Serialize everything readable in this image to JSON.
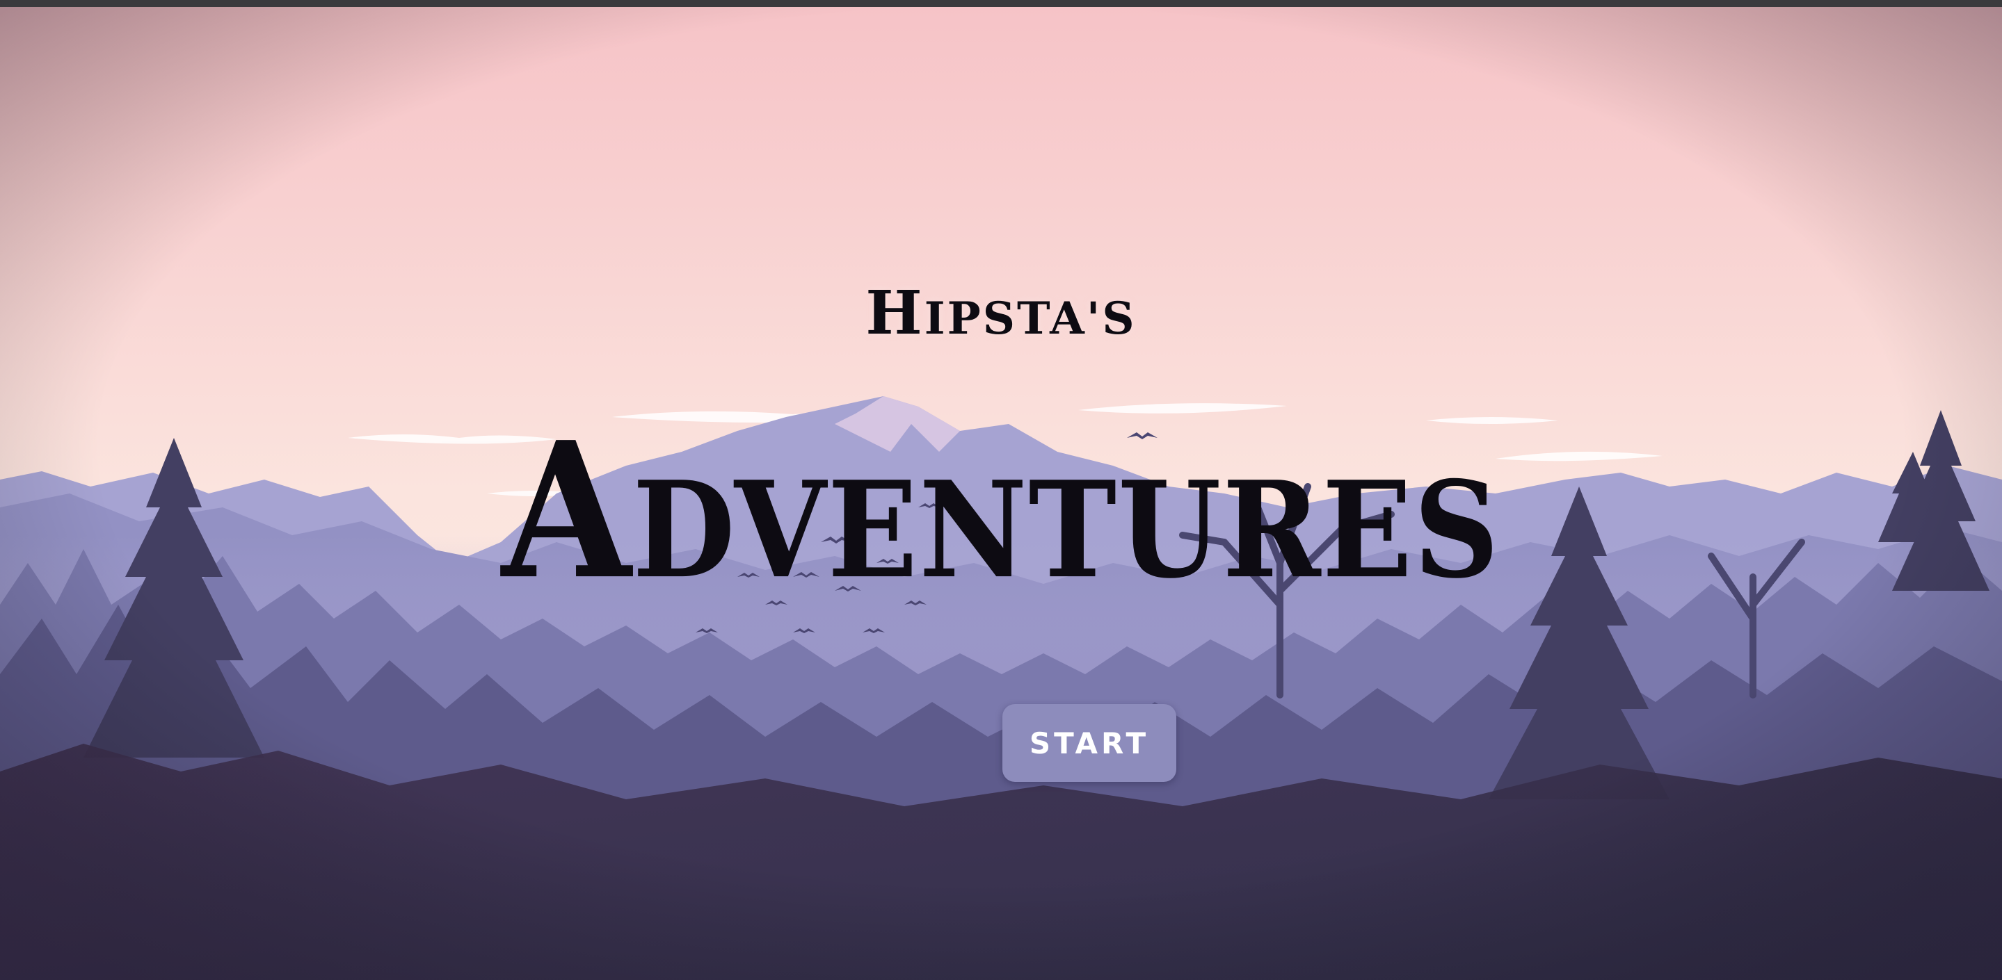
{
  "game": {
    "title_small_first": "H",
    "title_small_rest": "IPSTA'S",
    "title_big_first": "A",
    "title_big_rest": "DVENTURES",
    "start_label": "START"
  },
  "colors": {
    "sky_top": "#f6c4c8",
    "sky_bottom": "#fbe8e2",
    "mountains_far": "#8e8cc0",
    "forest_mid": "#6a6a9c",
    "forest_dark": "#3b3758",
    "button": "#8d8cbc"
  }
}
